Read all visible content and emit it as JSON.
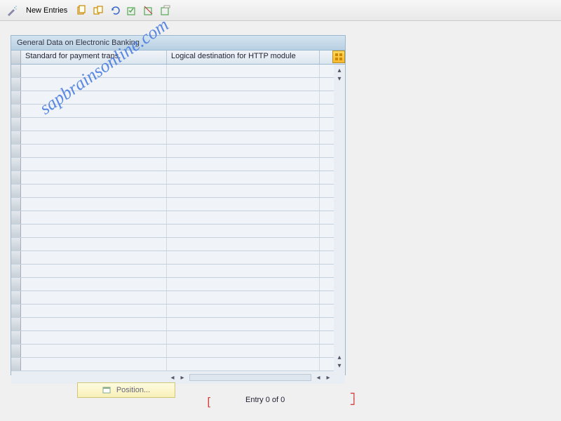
{
  "toolbar": {
    "new_entries_label": "New Entries"
  },
  "panel": {
    "title": "General Data on Electronic Banking",
    "columns": {
      "col1": "Standard for payment trans.",
      "col2": "Logical destination for HTTP module"
    }
  },
  "footer": {
    "position_label": "Position...",
    "entry_label": "Entry 0 of 0"
  },
  "watermark": "sapbrainsonline.com",
  "row_count": 23
}
